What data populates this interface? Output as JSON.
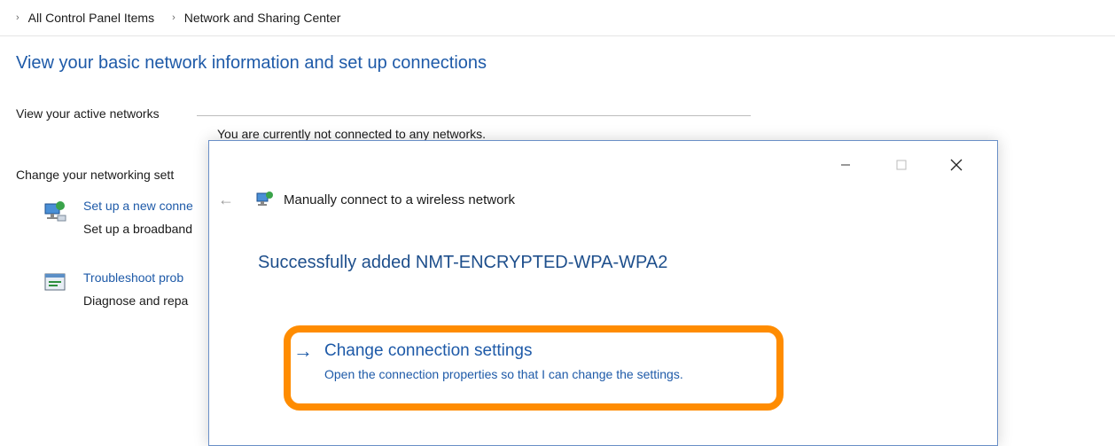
{
  "breadcrumb": {
    "items": [
      "All Control Panel Items",
      "Network and Sharing Center"
    ]
  },
  "page": {
    "title": "View your basic network information and set up connections",
    "active_networks_label": "View your active networks",
    "not_connected_text": "You are currently not connected to any networks.",
    "change_settings_label": "Change your networking sett"
  },
  "tasks": [
    {
      "link": "Set up a new conne",
      "desc": "Set up a broadband",
      "icon": "network-setup-icon"
    },
    {
      "link": "Troubleshoot prob",
      "desc": "Diagnose and repa",
      "icon": "troubleshoot-icon"
    }
  ],
  "dialog": {
    "title": "Manually connect to a wireless network",
    "success_message": "Successfully added NMT-ENCRYPTED-WPA-WPA2",
    "option_title": "Change connection settings",
    "option_desc": "Open the connection properties so that I can change the settings.",
    "highlight_color": "#ff8c00",
    "link_color": "#1e5aa8",
    "back_icon": "back-arrow-icon",
    "option_icon": "right-arrow-icon"
  }
}
